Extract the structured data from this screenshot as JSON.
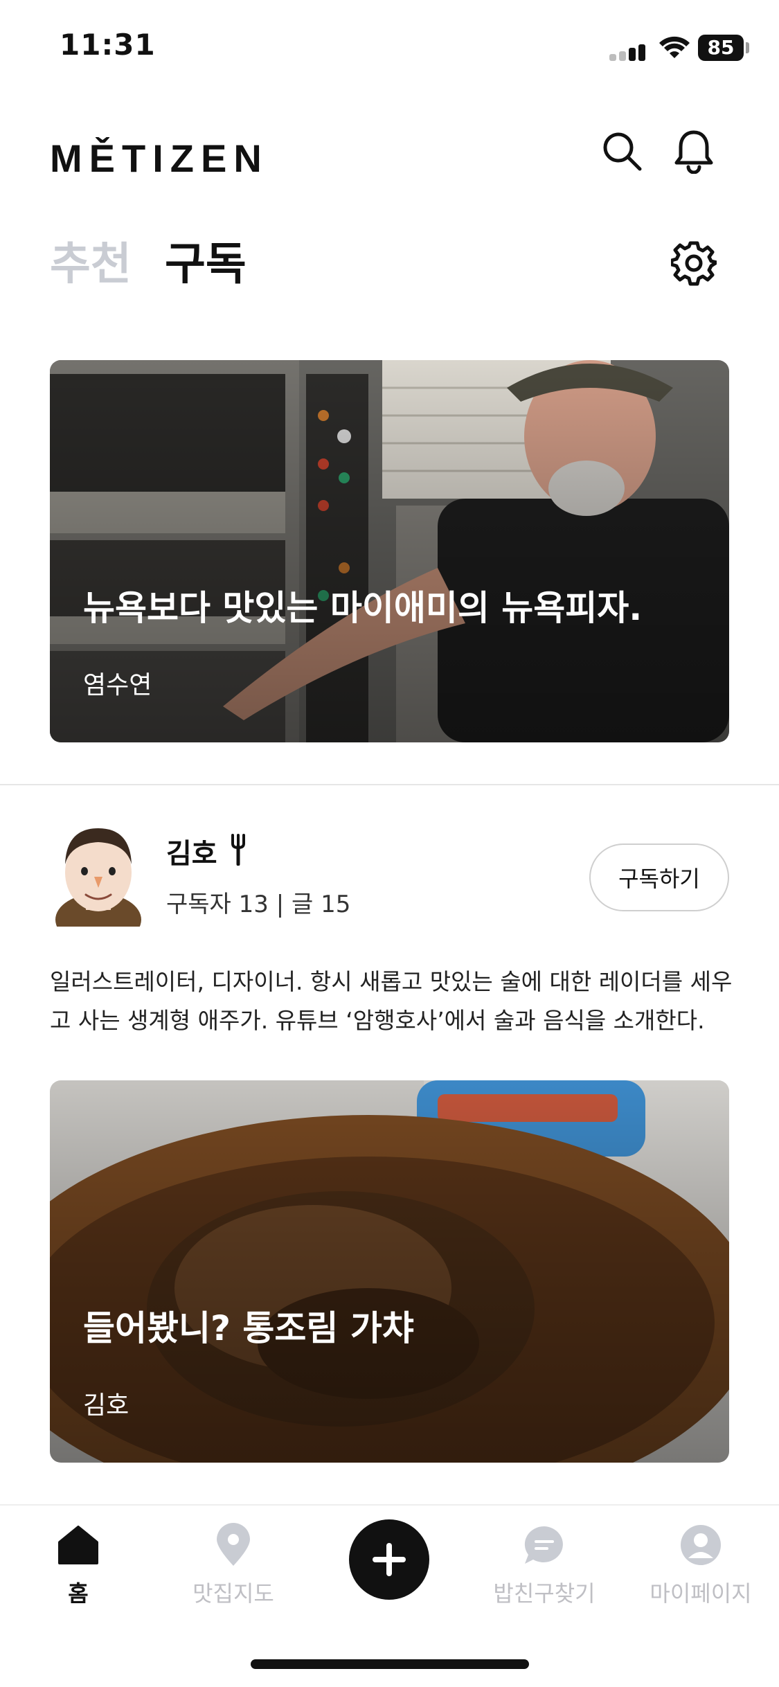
{
  "status_bar": {
    "time": "11:31",
    "battery": "85"
  },
  "header": {
    "logo": "MĚTIZEN",
    "search_icon": "search-icon",
    "bell_icon": "bell-icon"
  },
  "tabs": [
    {
      "label": "추천",
      "active": false
    },
    {
      "label": "구독",
      "active": true
    }
  ],
  "settings_icon": "gear-icon",
  "featured_card": {
    "title": "뉴욕보다 맛있는 마이애미의 뉴욕피자.",
    "author": "염수연",
    "image": "Man in cap and black t-shirt standing by a pizza oven with pizza boxes stacked behind"
  },
  "profile": {
    "name": "김호",
    "badge_icon": "fork-icon",
    "stats": "구독자 13 | 글 15",
    "subscribe_label": "구독하기",
    "bio": "일러스트레이터, 디자이너. 항시 새롭고 맛있는 술에 대한 레이더를 세우고 사는 생계형 애주가. 유튜브 ‘암행호사’에서 술과 음식을 소개한다."
  },
  "post_card": {
    "title": "들어봤니? 통조림 가챠",
    "author": "김호",
    "image": "Plate of braised meat with sauce and a can in the background"
  },
  "bottom_nav": {
    "items": [
      {
        "label": "홈",
        "icon": "home-icon",
        "active": true
      },
      {
        "label": "맛집지도",
        "icon": "map-pin-icon",
        "active": false
      },
      {
        "label": "",
        "icon": "plus-icon",
        "active": false
      },
      {
        "label": "밥친구찾기",
        "icon": "chat-icon",
        "active": false
      },
      {
        "label": "마이페이지",
        "icon": "user-icon",
        "active": false
      }
    ]
  },
  "colors": {
    "accent": "#111111",
    "inactive": "#c9ccd3",
    "divider": "#e6e6e6"
  }
}
